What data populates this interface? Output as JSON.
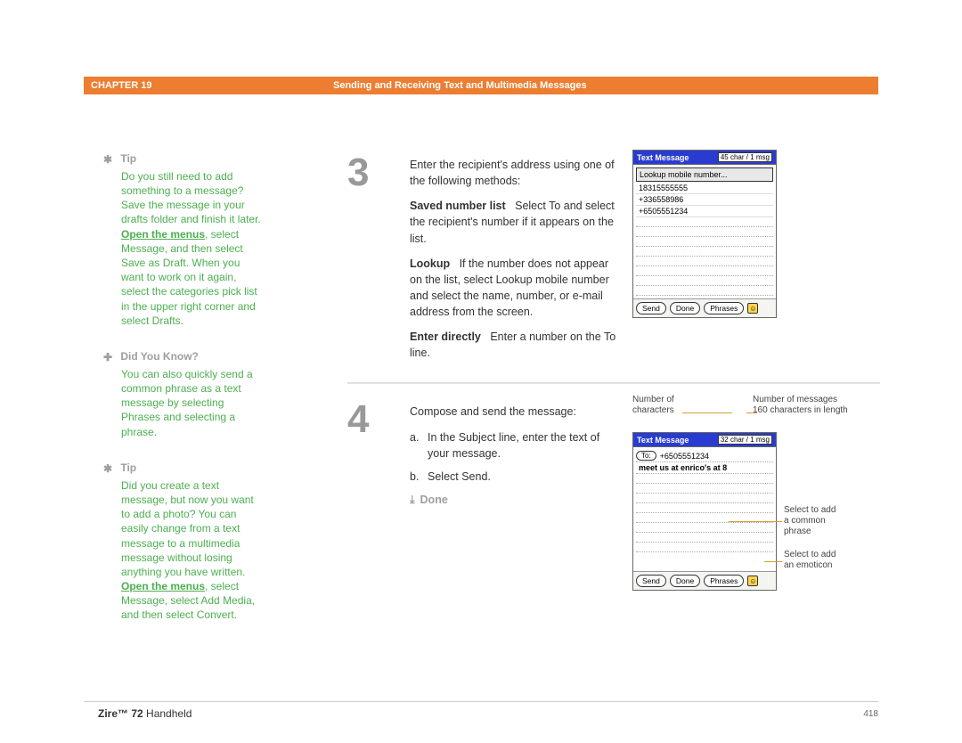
{
  "header": {
    "chapter": "CHAPTER 19",
    "title": "Sending and Receiving Text and Multimedia Messages"
  },
  "sidebar": {
    "tip1_label": "Tip",
    "tip1_body": "Do you still need to add something to a message? Save the message in your drafts folder and finish it later. ",
    "tip1_link": "Open the menus",
    "tip1_body2": ", select Message, and then select Save as Draft. When you want to work on it again, select the categories pick list in the upper right corner and select Drafts.",
    "dyk_label": "Did You Know?",
    "dyk_body": "You can also quickly send a common phrase as a text message by selecting Phrases and selecting a phrase.",
    "tip2_label": "Tip",
    "tip2_body": "Did you create a text message, but now you want to add a photo? You can easily change from a text message to a multimedia message without losing anything you have written. ",
    "tip2_link": "Open the menus",
    "tip2_body2": ", select Message, select Add Media, and then select Convert."
  },
  "steps": {
    "s3": {
      "num": "3",
      "intro": "Enter the recipient's address using one of the following methods:",
      "saved_label": "Saved number list",
      "saved_body": "Select To and select the recipient's number if it appears on the list.",
      "lookup_label": "Lookup",
      "lookup_body": "If the number does not appear on the list, select Lookup mobile number and select the name, number, or e-mail address from the screen.",
      "enter_label": "Enter directly",
      "enter_body": "Enter a number on the To line.",
      "palm": {
        "title": "Text Message",
        "char": "45 char / 1 msg",
        "lookup": "Lookup mobile number...",
        "n1": "18315555555",
        "n2": "+336558986",
        "n3": "+6505551234",
        "send": "Send",
        "done": "Done",
        "phrases": "Phrases"
      }
    },
    "s4": {
      "num": "4",
      "intro": "Compose and send the message:",
      "a": "In the Subject line, enter the text of your message.",
      "b": "Select Send.",
      "done": "Done",
      "palm": {
        "title": "Text Message",
        "char": "32 char / 1 msg",
        "to": "To:",
        "to_num": "+6505551234",
        "msg": "meet us at enrico's at 8",
        "send": "Send",
        "done": "Done",
        "phrases": "Phrases"
      },
      "annot": {
        "chars1": "Number of",
        "chars2": "characters",
        "msgs1": "Number of messages",
        "msgs2": "160 characters in length",
        "phrase1": "Select to add",
        "phrase2": "a common",
        "phrase3": "phrase",
        "emot1": "Select to add",
        "emot2": "an emoticon"
      }
    }
  },
  "footer": {
    "brand": "Zire™ 72",
    "model": "Handheld",
    "page": "418"
  }
}
